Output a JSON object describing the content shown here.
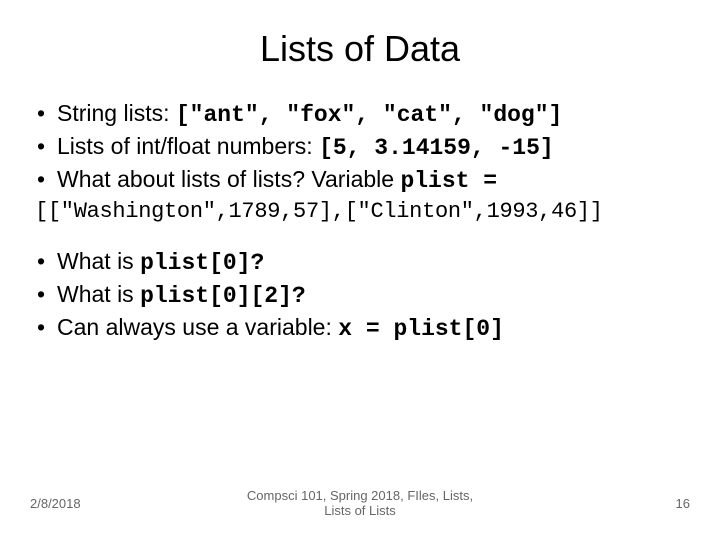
{
  "title": "Lists of Data",
  "block1": {
    "b1_pre": "String lists: ",
    "b1_code": "[\"ant\", \"fox\", \"cat\", \"dog\"]",
    "b2_pre": "Lists of int/float numbers: ",
    "b2_code": "[5, 3.14159, -15]",
    "b3_pre": "What about lists of lists? Variable ",
    "b3_code": "plist ="
  },
  "nested": "[[\"Washington\",1789,57],[\"Clinton\",1993,46]]",
  "block2": {
    "b1_pre": "What is ",
    "b1_code": "plist[0]?",
    "b2_pre": "What is ",
    "b2_code": "plist[0][2]?",
    "b3_pre": "Can always use a variable: ",
    "b3_code": "x = plist[0]"
  },
  "footer": {
    "date": "2/8/2018",
    "center_l1": "Compsci 101, Spring 2018, FIles, Lists,",
    "center_l2": "Lists of Lists",
    "page": "16"
  }
}
